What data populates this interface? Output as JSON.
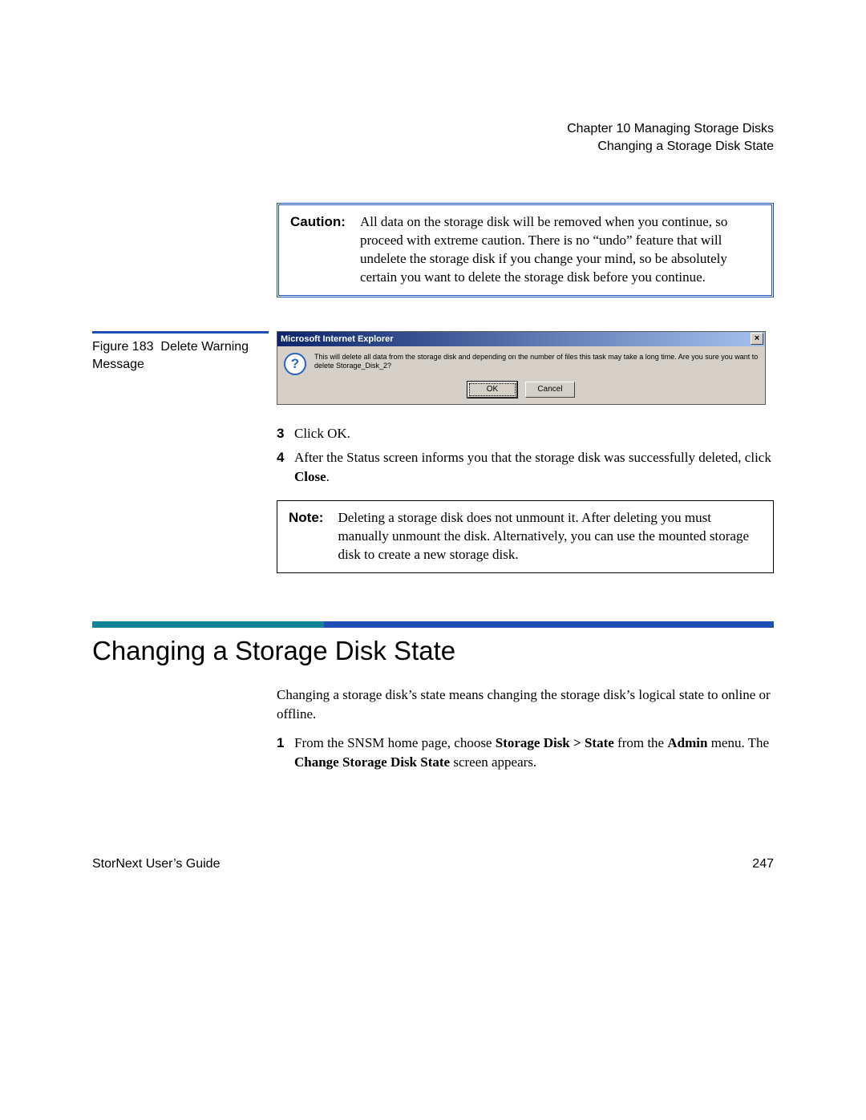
{
  "header": {
    "chapter_line": "Chapter 10  Managing Storage Disks",
    "section_line": "Changing a Storage Disk State"
  },
  "caution": {
    "label": "Caution:",
    "text": "All data on the storage disk will be removed when you continue, so proceed with extreme caution. There is no “undo” feature that will undelete the storage disk if you change your mind, so be absolutely certain you want to delete the storage disk before you continue."
  },
  "figure": {
    "label": "Figure 183",
    "title": "Delete Warning Message"
  },
  "dialog": {
    "title": "Microsoft Internet Explorer",
    "close_glyph": "×",
    "message": "This will delete all data from the storage disk and depending on the number of files this task may take a long time.  Are you sure you want to delete Storage_Disk_2?",
    "ok_label": "OK",
    "cancel_label": "Cancel"
  },
  "steps_a": [
    {
      "num": "3",
      "html": "Click OK."
    },
    {
      "num": "4",
      "html": "After the Status screen informs you that the storage disk was successfully deleted, click <b>Close</b>."
    }
  ],
  "note": {
    "label": "Note:",
    "text": "Deleting a storage disk does not unmount it. After deleting you must manually unmount the disk. Alternatively, you can use the mounted storage disk to create a new storage disk."
  },
  "section_title": "Changing a Storage Disk State",
  "intro_text": "Changing a storage disk’s state means changing the storage disk’s logical state to online or offline.",
  "steps_b": [
    {
      "num": "1",
      "html": "From the SNSM home page, choose <b>Storage Disk &gt; State</b> from the <b>Admin</b> menu. The <b>Change Storage Disk State</b> screen appears."
    }
  ],
  "footer": {
    "left": "StorNext User’s Guide",
    "right": "247"
  }
}
